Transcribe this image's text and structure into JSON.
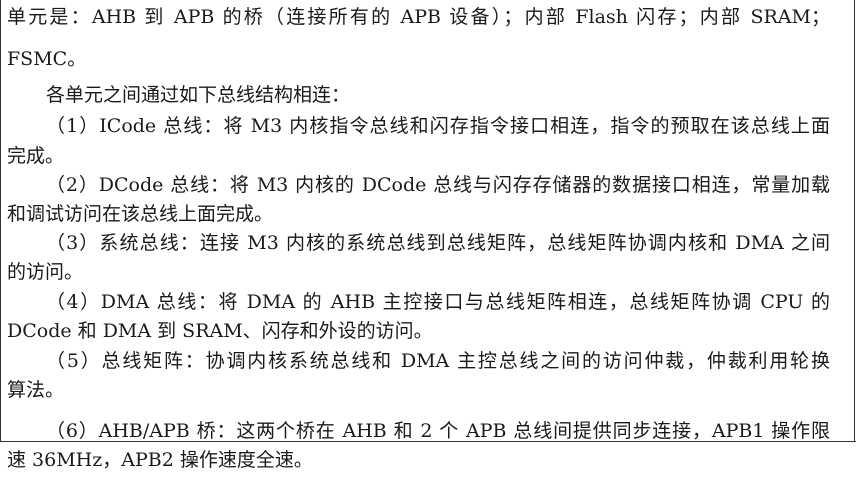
{
  "document": {
    "lines": [
      "单元是：AHB 到 APB 的桥（连接所有的 APB 设备）；内部 Flash 闪存；内部 SRAM；",
      "FSMC。",
      "各单元之间通过如下总线结构相连：",
      "（1）ICode 总线：将 M3 内核指令总线和闪存指令接口相连，指令的预取在该总线上面",
      "完成。",
      "（2）DCode 总线：将 M3 内核的 DCode 总线与闪存存储器的数据接口相连，常量加载",
      "和调试访问在该总线上面完成。",
      "（3）系统总线：连接 M3 内核的系统总线到总线矩阵，总线矩阵协调内核和 DMA 之间",
      "的访问。",
      "（4）DMA 总线：将 DMA 的 AHB 主控接口与总线矩阵相连，总线矩阵协调 CPU 的",
      "DCode 和 DMA 到 SRAM、闪存和外设的访问。",
      "（5）总线矩阵：协调内核系统总线和 DMA 主控总线之间的访问仲裁，仲裁利用轮换",
      "算法。",
      "（6）AHB/APB 桥：这两个桥在 AHB 和 2 个 APB 总线间提供同步连接，APB1 操作限",
      "速 36MHz，APB2 操作速度全速。"
    ]
  }
}
